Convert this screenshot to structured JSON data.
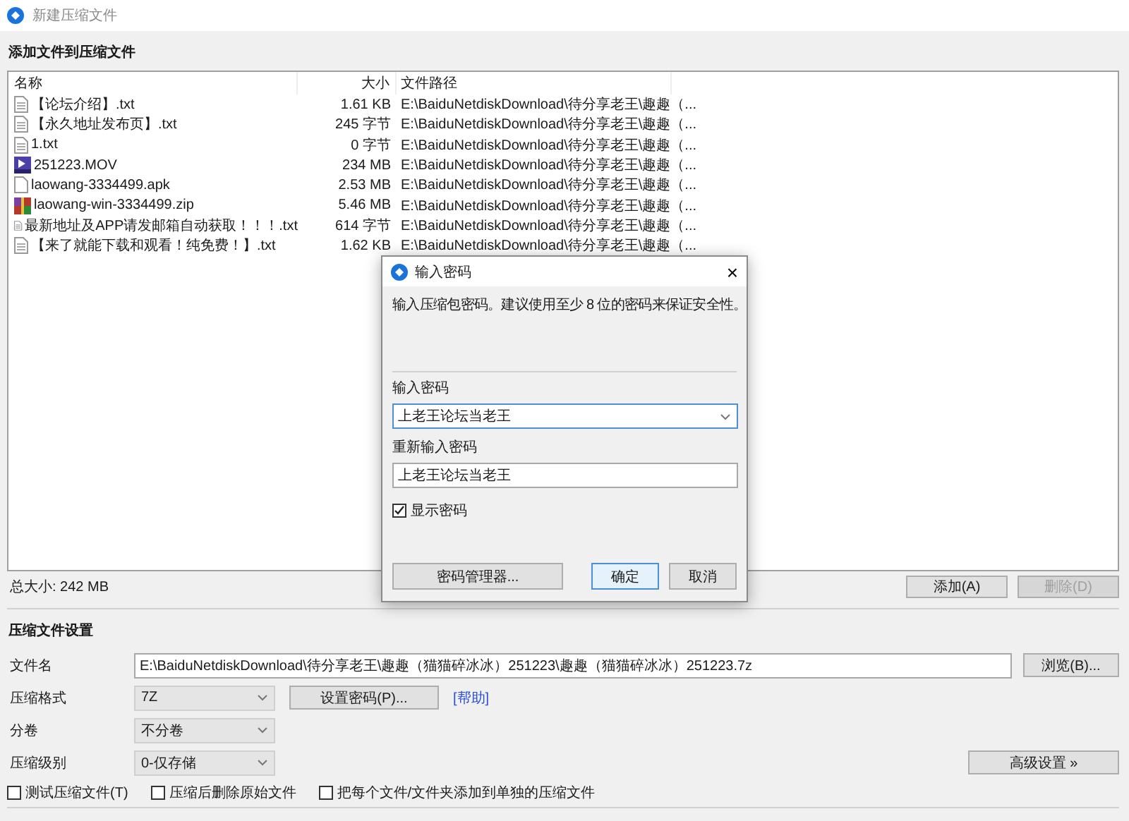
{
  "window": {
    "title": "新建压缩文件"
  },
  "files_section": {
    "heading": "添加文件到压缩文件",
    "columns": [
      "名称",
      "大小",
      "文件路径"
    ],
    "rows": [
      {
        "kind": "text",
        "name": "【论坛介绍】.txt",
        "size": "1.61 KB",
        "path": "E:\\BaiduNetdiskDownload\\待分享老王\\趣趣（..."
      },
      {
        "kind": "text",
        "name": "【永久地址发布页】.txt",
        "size": "245 字节",
        "path": "E:\\BaiduNetdiskDownload\\待分享老王\\趣趣（..."
      },
      {
        "kind": "text",
        "name": "1.txt",
        "size": "0 字节",
        "path": "E:\\BaiduNetdiskDownload\\待分享老王\\趣趣（..."
      },
      {
        "kind": "video",
        "name": "251223.MOV",
        "size": "234 MB",
        "path": "E:\\BaiduNetdiskDownload\\待分享老王\\趣趣（..."
      },
      {
        "kind": "blank",
        "name": "laowang-3334499.apk",
        "size": "2.53 MB",
        "path": "E:\\BaiduNetdiskDownload\\待分享老王\\趣趣（..."
      },
      {
        "kind": "archive",
        "name": "laowang-win-3334499.zip",
        "size": "5.46 MB",
        "path": "E:\\BaiduNetdiskDownload\\待分享老王\\趣趣（..."
      },
      {
        "kind": "text",
        "name": "最新地址及APP请发邮箱自动获取！！！.txt",
        "size": "614 字节",
        "path": "E:\\BaiduNetdiskDownload\\待分享老王\\趣趣（..."
      },
      {
        "kind": "text",
        "name": "【来了就能下载和观看！纯免费！】.txt",
        "size": "1.62 KB",
        "path": "E:\\BaiduNetdiskDownload\\待分享老王\\趣趣（..."
      }
    ],
    "total": "总大小: 242 MB",
    "buttons": [
      {
        "label": "添加(A)",
        "disabled": false
      },
      {
        "label": "删除(D)",
        "disabled": true
      }
    ]
  },
  "settings": {
    "heading": "压缩文件设置",
    "file_name": {
      "label": "文件名",
      "value": "E:\\BaiduNetdiskDownload\\待分享老王\\趣趣（猫猫碎冰冰）251223\\趣趣（猫猫碎冰冰）251223.7z",
      "button": "浏览(B)..."
    },
    "format": {
      "label": "压缩格式",
      "value": "7Z",
      "button": "设置密码(P)...",
      "link": "[帮助]"
    },
    "split": {
      "label": "分卷",
      "value": "不分卷"
    },
    "level": {
      "label": "压缩级别",
      "value": "0-仅存储",
      "button": "高级设置 »"
    },
    "options": [
      {
        "label": "测试压缩文件(T)",
        "checked": false
      },
      {
        "label": "压缩后删除原始文件",
        "checked": false
      },
      {
        "label": "把每个文件/文件夹添加到单独的压缩文件",
        "checked": false
      }
    ]
  },
  "dialog": {
    "title": "输入密码",
    "close": "×",
    "hint": "输入压缩包密码。建议使用至少 8 位的密码来保证安全性。",
    "password_label": "输入密码",
    "password": "上老王论坛当老王",
    "repeat_label": "重新输入密码",
    "repeat": "上老王论坛当老王",
    "show_password": {
      "label": "显示密码",
      "checked": true
    },
    "manager_button": "密码管理器...",
    "ok_button": "确定",
    "cancel_button": "取消"
  }
}
